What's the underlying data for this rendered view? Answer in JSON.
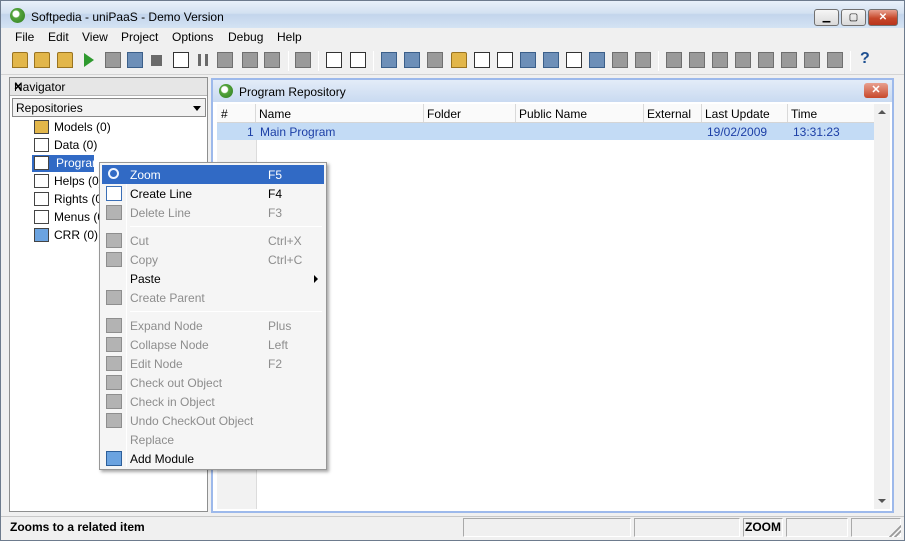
{
  "window": {
    "title": "Softpedia - uniPaaS - Demo Version",
    "controls": {
      "minimize": "▁",
      "maximize": "▢",
      "close": "✕"
    }
  },
  "menubar": [
    "File",
    "Edit",
    "View",
    "Project",
    "Options",
    "Debug",
    "Help"
  ],
  "toolbar": {
    "help_label": "?"
  },
  "navigator": {
    "title": "Navigator",
    "close": "×",
    "combo_value": "Repositories",
    "items": [
      {
        "label": "Models  (0)",
        "icon": "models-icon"
      },
      {
        "label": "Data  (0)",
        "icon": "data-icon"
      },
      {
        "label": "Programs  (1)",
        "icon": "programs-icon",
        "selected": true
      },
      {
        "label": "Helps  (0)",
        "icon": "helps-icon"
      },
      {
        "label": "Rights  (0)",
        "icon": "rights-icon"
      },
      {
        "label": "Menus  (0)",
        "icon": "menus-icon"
      },
      {
        "label": "CRR  (0)",
        "icon": "crr-icon"
      }
    ]
  },
  "repository": {
    "title": "Program Repository",
    "close": "✕",
    "columns": [
      "#",
      "Name",
      "Folder",
      "Public Name",
      "External",
      "Last Update",
      "Time"
    ],
    "rows": [
      {
        "num": "1",
        "name": "Main Program",
        "folder": "",
        "public_name": "",
        "external": "",
        "last_update": "19/02/2009",
        "time": "13:31:23"
      }
    ]
  },
  "context_menu": {
    "items": [
      {
        "label": "Zoom",
        "shortcut": "F5",
        "state": "highlighted",
        "icon": "zoom-icon"
      },
      {
        "label": "Create Line",
        "shortcut": "F4",
        "state": "enabled",
        "icon": "create-line-icon"
      },
      {
        "label": "Delete Line",
        "shortcut": "F3",
        "state": "disabled",
        "icon": "delete-line-icon"
      },
      {
        "label": "Cut",
        "shortcut": "Ctrl+X",
        "state": "disabled",
        "icon": "cut-icon"
      },
      {
        "label": "Copy",
        "shortcut": "Ctrl+C",
        "state": "disabled",
        "icon": "copy-icon"
      },
      {
        "label": "Paste",
        "shortcut": "",
        "state": "enabled",
        "submenu": true
      },
      {
        "label": "Create Parent",
        "shortcut": "",
        "state": "disabled",
        "icon": "create-parent-icon"
      },
      {
        "label": "Expand Node",
        "shortcut": "Plus",
        "state": "disabled",
        "icon": "expand-node-icon"
      },
      {
        "label": "Collapse Node",
        "shortcut": "Left",
        "state": "disabled",
        "icon": "collapse-node-icon"
      },
      {
        "label": "Edit Node",
        "shortcut": "F2",
        "state": "disabled",
        "icon": "edit-node-icon"
      },
      {
        "label": "Check out Object",
        "shortcut": "",
        "state": "disabled",
        "icon": "check-out-icon"
      },
      {
        "label": "Check in Object",
        "shortcut": "",
        "state": "disabled",
        "icon": "check-in-icon"
      },
      {
        "label": "Undo CheckOut Object",
        "shortcut": "",
        "state": "disabled",
        "icon": "undo-checkout-icon"
      },
      {
        "label": "Replace",
        "shortcut": "",
        "state": "disabled"
      },
      {
        "label": "Add Module",
        "shortcut": "",
        "state": "enabled",
        "icon": "add-module-icon"
      }
    ]
  },
  "statusbar": {
    "message": "Zooms to a related item",
    "mode": "ZOOM"
  },
  "colors": {
    "selection": "#316ac5",
    "row_highlight": "#c3dbf5",
    "row_text": "#1c3fa6",
    "disabled_text": "#8d8d8d"
  }
}
